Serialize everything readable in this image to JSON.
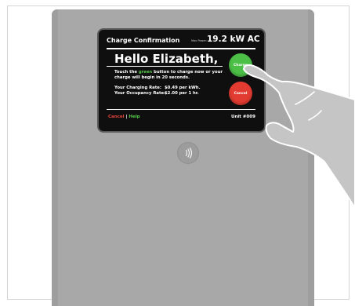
{
  "screen": {
    "title": "Charge Confirmation",
    "max_power_label": "Max Power:",
    "max_power_value": "19.2 kW AC",
    "greeting": "Hello Elizabeth,",
    "instruction_pre": "Touch the ",
    "instruction_green": "green",
    "instruction_post": " button to charge now or your charge will begin in 20 seconds.",
    "charging_rate_label": "Your Charging Rate:",
    "charging_rate_value": "$0.49 per kWh.",
    "occupancy_rate_label": "Your Occupancy Rate:",
    "occupancy_rate_value": "$2.00 per 1 hr.",
    "cancel_link": "Cancel",
    "separator": "|",
    "help_link": "Help",
    "unit_number": "Unit #009"
  },
  "buttons": {
    "charge_label": "Charge",
    "cancel_label": "Cancel"
  },
  "colors": {
    "charge_green": "#4cbf47",
    "cancel_red": "#e23b31",
    "unit_body": "#a8a8a8",
    "screen_bg": "#0f0f0f"
  },
  "icons": {
    "rfid_reader": "contactless-icon",
    "hand": "hand-pointer-illustration"
  }
}
